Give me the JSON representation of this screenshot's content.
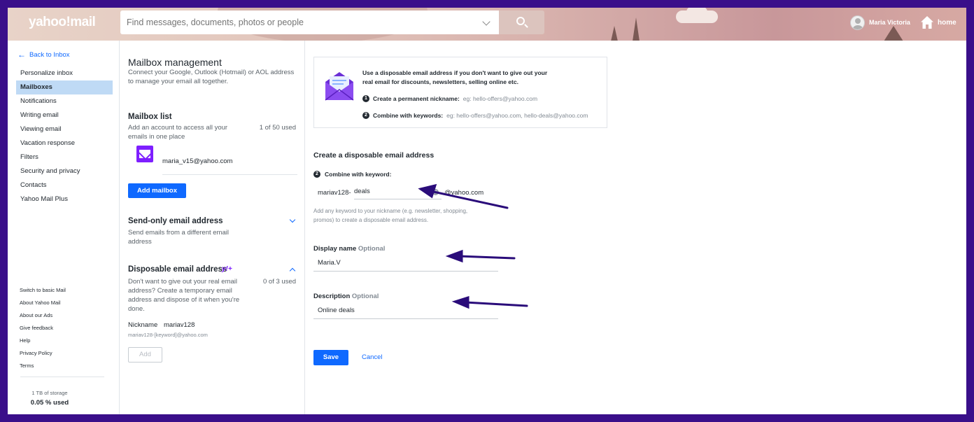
{
  "header": {
    "logo": "yahoo!mail",
    "search_placeholder": "Find messages, documents, photos or people",
    "user_name": "Maria Victoria",
    "home_label": "home"
  },
  "nav": {
    "back_label": "Back to Inbox",
    "items": [
      {
        "label": "Personalize inbox"
      },
      {
        "label": "Mailboxes",
        "active": true
      },
      {
        "label": "Notifications"
      },
      {
        "label": "Writing email"
      },
      {
        "label": "Viewing email"
      },
      {
        "label": "Vacation response"
      },
      {
        "label": "Filters"
      },
      {
        "label": "Security and privacy"
      },
      {
        "label": "Contacts"
      },
      {
        "label": "Yahoo Mail Plus"
      }
    ],
    "footer_links": [
      "Switch to basic Mail",
      "About Yahoo Mail",
      "About our Ads",
      "Give feedback",
      "Help",
      "Privacy Policy",
      "Terms"
    ],
    "storage_line1": "1 TB of storage",
    "storage_line2": "0.05 % used"
  },
  "mailbox": {
    "title": "Mailbox management",
    "subtitle": "Connect your Google, Outlook (Hotmail) or AOL address to manage your email all together.",
    "list_title": "Mailbox list",
    "list_desc": "Add an account to access all your emails in one place",
    "list_count": "1 of 50 used",
    "account_email": "maria_v15@yahoo.com",
    "add_mailbox_label": "Add mailbox",
    "send_only_title": "Send-only email address",
    "send_only_desc": "Send emails from a different email address",
    "disposable_title": "Disposable email address",
    "disposable_badge": "y!+",
    "disposable_desc": "Don't want to give out your real email address? Create a temporary email address and dispose of it when you're done.",
    "disposable_count": "0 of 3 used",
    "nickname_label": "Nickname",
    "nickname_value": "mariav128",
    "nickname_pattern": "mariav128-[keyword]@yahoo.com",
    "add_label": "Add"
  },
  "disposable_form": {
    "info_title": "Use a disposable email address if you don't want to give out your real email for discounts, newsletters, selling online etc.",
    "step1_label": "Create a permanent nickname:",
    "step1_example": "eg: hello-offers@yahoo.com",
    "step2_label": "Combine with keywords:",
    "step2_example": "eg: hello-offers@yahoo.com, hello-deals@yahoo.com",
    "section_title": "Create a disposable email address",
    "combine_label": "Combine with keyword:",
    "prefix": "mariav128-",
    "keyword_value": "deals",
    "domain": "@yahoo.com",
    "keyword_hint": "Add any keyword to your nickname (e.g. newsletter, shopping, promos) to create a disposable email address.",
    "display_name_label": "Display name",
    "optional_label": "Optional",
    "display_name_value": "Maria.V",
    "description_label": "Description",
    "description_value": "Online deals",
    "save_label": "Save",
    "cancel_label": "Cancel"
  },
  "colors": {
    "frame": "#3a0f8a",
    "accent": "#0f69ff",
    "brand_purple": "#7e1fff",
    "annotation_arrow": "#2a0c7a"
  }
}
